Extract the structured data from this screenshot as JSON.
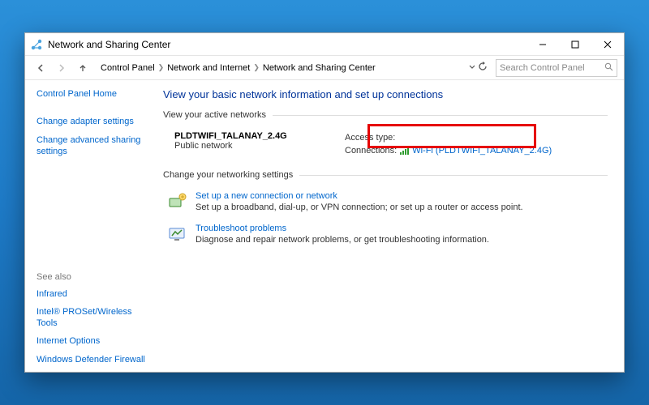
{
  "window": {
    "title": "Network and Sharing Center"
  },
  "breadcrumb": {
    "items": [
      "Control Panel",
      "Network and Internet",
      "Network and Sharing Center"
    ]
  },
  "search": {
    "placeholder": "Search Control Panel"
  },
  "sidebar": {
    "home": "Control Panel Home",
    "links": [
      "Change adapter settings",
      "Change advanced sharing settings"
    ],
    "see_also_label": "See also",
    "see_also": [
      "Infrared",
      "Intel® PROSet/Wireless Tools",
      "Internet Options",
      "Windows Defender Firewall"
    ]
  },
  "main": {
    "heading": "View your basic network information and set up connections",
    "active_networks_label": "View your active networks",
    "network": {
      "name": "PLDTWIFI_TALANAY_2.4G",
      "category": "Public network",
      "access_label": "Access type:",
      "connections_label": "Connections:",
      "connection_link": "Wi-Fi (PLDTWIFI_TALANAY_2.4G)"
    },
    "change_settings_label": "Change your networking settings",
    "change_items": [
      {
        "title": "Set up a new connection or network",
        "desc": "Set up a broadband, dial-up, or VPN connection; or set up a router or access point."
      },
      {
        "title": "Troubleshoot problems",
        "desc": "Diagnose and repair network problems, or get troubleshooting information."
      }
    ]
  }
}
